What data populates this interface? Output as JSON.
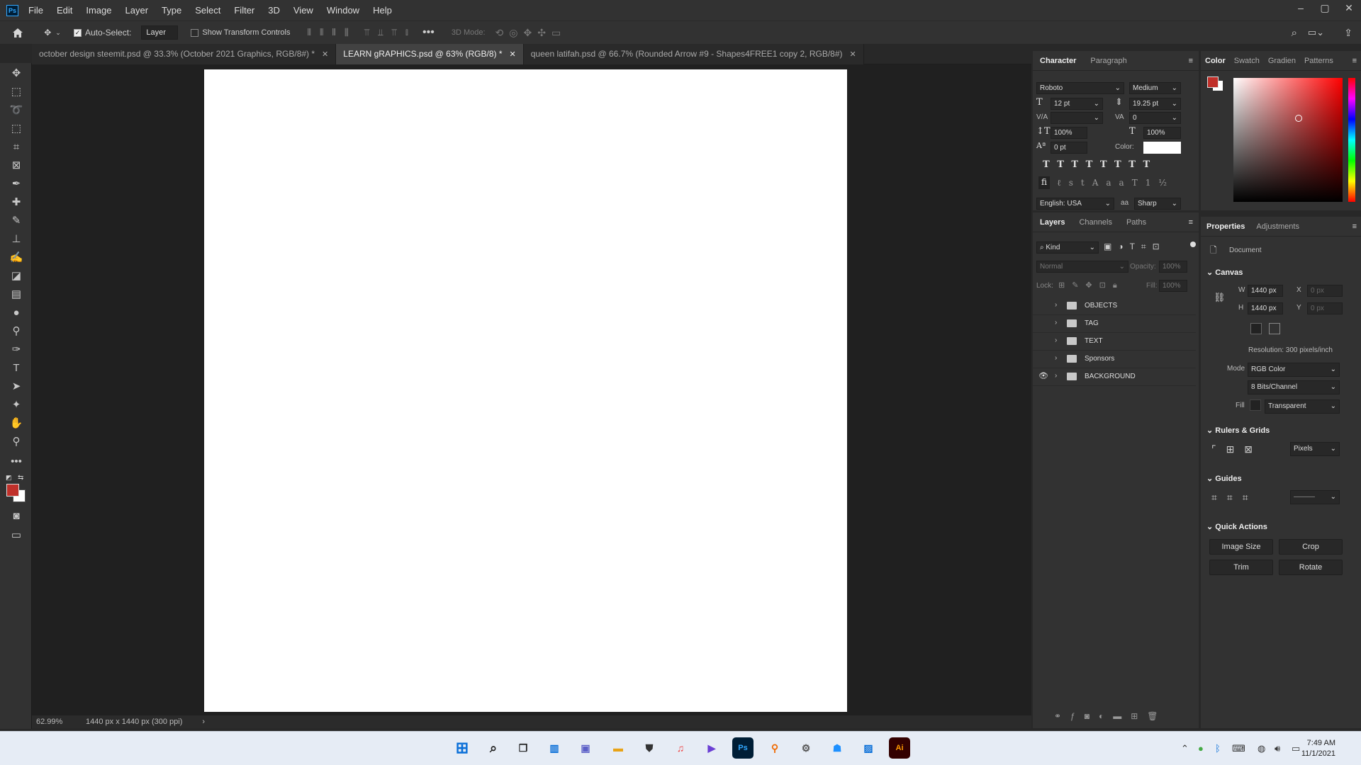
{
  "app": {
    "logo_text": "Ps"
  },
  "menu": [
    "File",
    "Edit",
    "Image",
    "Layer",
    "Type",
    "Select",
    "Filter",
    "3D",
    "View",
    "Window",
    "Help"
  ],
  "window_controls": {
    "minimize": "–",
    "maximize": "▢",
    "close": "✕"
  },
  "options": {
    "auto_select_label": "Auto-Select:",
    "auto_select_target": "Layer",
    "show_transform_label": "Show Transform Controls",
    "mode_3d_label": "3D Mode:"
  },
  "tabs": [
    {
      "label": "october design steemit.psd @ 33.3% (October 2021  Graphics, RGB/8#) *",
      "active": false
    },
    {
      "label": "LEARN gRAPHICS.psd @ 63% (RGB/8) *",
      "active": true
    },
    {
      "label": "queen latifah.psd @ 66.7% (Rounded Arrow #9 - Shapes4FREE1 copy 2, RGB/8#)",
      "active": false
    }
  ],
  "status": {
    "zoom": "62.99%",
    "doc_info": "1440 px x 1440 px (300 ppi)"
  },
  "character": {
    "tabs": [
      "Character",
      "Paragraph"
    ],
    "font_family": "Roboto",
    "font_style": "Medium",
    "size": "12 pt",
    "leading": "19.25 pt",
    "kerning": "",
    "tracking": "0",
    "vscale": "100%",
    "hscale": "100%",
    "baseline": "0 pt",
    "color_label": "Color:",
    "language": "English: USA",
    "aa_label": "aa",
    "antialias": "Sharp"
  },
  "layers_panel": {
    "tabs": [
      "Layers",
      "Channels",
      "Paths"
    ],
    "filter": "Kind",
    "blend": "Normal",
    "opacity_label": "Opacity:",
    "opacity": "100%",
    "lock_label": "Lock:",
    "fill_label": "Fill:",
    "fill": "100%",
    "layers": [
      {
        "name": "OBJECTS",
        "visible": false
      },
      {
        "name": "TAG",
        "visible": false
      },
      {
        "name": "TEXT",
        "visible": false
      },
      {
        "name": "Sponsors",
        "visible": false
      },
      {
        "name": "BACKGROUND",
        "visible": true
      }
    ]
  },
  "color_panel": {
    "tabs": [
      "Color",
      "Swatch",
      "Gradien",
      "Patterns"
    ],
    "foreground": "#c0302a",
    "background": "#ffffff"
  },
  "properties": {
    "tabs": [
      "Properties",
      "Adjustments"
    ],
    "doc_label": "Document",
    "canvas_label": "Canvas",
    "w_label": "W",
    "w": "1440 px",
    "h_label": "H",
    "h": "1440 px",
    "x_label": "X",
    "x": "0 px",
    "y_label": "Y",
    "y": "0 px",
    "resolution": "Resolution: 300 pixels/inch",
    "mode_label": "Mode",
    "mode": "RGB Color",
    "bits": "8 Bits/Channel",
    "fill_label": "Fill",
    "fill": "Transparent",
    "rulers_label": "Rulers & Grids",
    "units": "Pixels",
    "guides_label": "Guides",
    "quick_actions_label": "Quick Actions",
    "actions": [
      "Image Size",
      "Crop",
      "Trim",
      "Rotate"
    ]
  },
  "taskbar": {
    "time": "7:49 AM",
    "date": "11/1/2021"
  }
}
